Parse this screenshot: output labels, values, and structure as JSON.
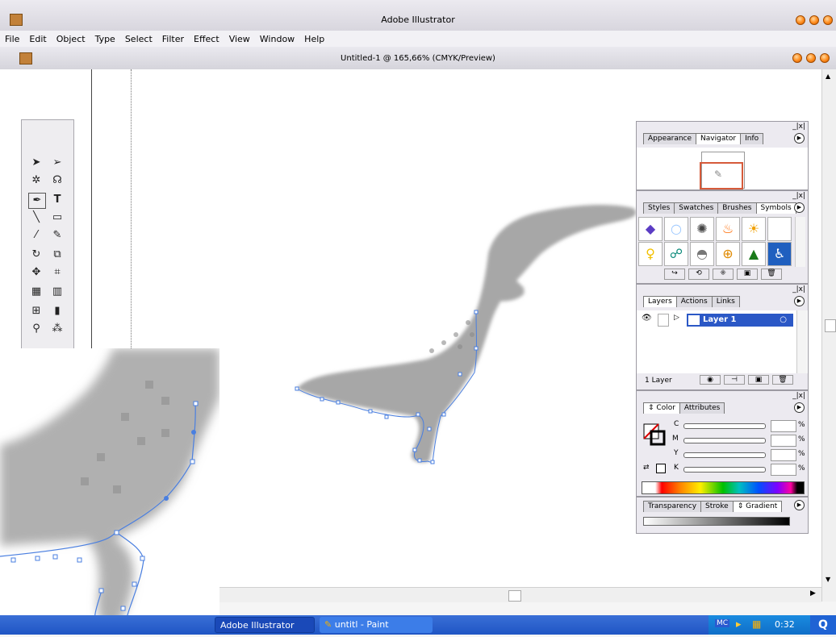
{
  "app": {
    "title": "Adobe Illustrator"
  },
  "menu": [
    "File",
    "Edit",
    "Object",
    "Type",
    "Select",
    "Filter",
    "Effect",
    "View",
    "Window",
    "Help"
  ],
  "document": {
    "title": "Untitled-1 @ 165,66% (CMYK/Preview)"
  },
  "panels": {
    "navigator": {
      "tabs": [
        "Appearance",
        "Navigator",
        "Info"
      ],
      "active": "Navigator"
    },
    "styles": {
      "tabs": [
        "Styles",
        "Swatches",
        "Brushes",
        "Symbols"
      ],
      "active": "Symbols"
    },
    "layers": {
      "tabs": [
        "Layers",
        "Actions",
        "Links"
      ],
      "active": "Layers",
      "layer_name": "Layer 1",
      "count_label": "1 Layer"
    },
    "color": {
      "tabs": [
        "Color",
        "Attributes"
      ],
      "active": "Color",
      "channels": [
        "C",
        "M",
        "Y",
        "K"
      ],
      "unit": "%"
    },
    "gradient": {
      "tabs": [
        "Transparency",
        "Stroke",
        "Gradient"
      ],
      "active": "Gradient"
    }
  },
  "taskbar": {
    "items": [
      "Adobe Illustrator",
      "untitl - Paint"
    ],
    "tray_label": "MC",
    "clock": "0:32"
  },
  "colors": {
    "selection": "#4a7fe0",
    "taskbar": "#245edb",
    "layer_highlight": "#2b58c6"
  }
}
